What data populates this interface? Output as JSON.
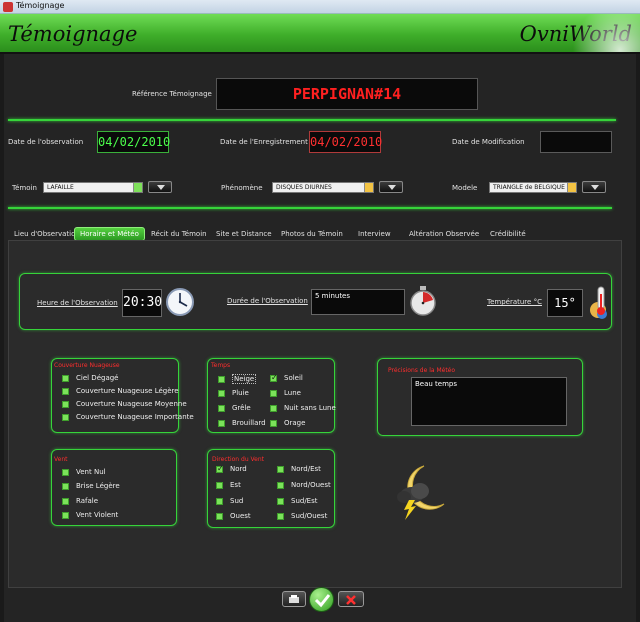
{
  "window": {
    "title": "Témoignage"
  },
  "header": {
    "title": "Témoignage",
    "brand": "OvniWorld"
  },
  "reference": {
    "label": "Référence Témoignage",
    "value": "PERPIGNAN#14"
  },
  "dates": {
    "observation_label": "Date de l'observation",
    "observation_value": "04/02/2010",
    "enregistrement_label": "Date de l'Enregistrement",
    "enregistrement_value": "04/02/2010",
    "modification_label": "Date de Modification",
    "modification_value": ""
  },
  "selectors": {
    "temoin_label": "Témoin",
    "temoin_value": "LAFAILLE",
    "phenomene_label": "Phénomène",
    "phenomene_value": "DISQUES DIURNES",
    "modele_label": "Modele",
    "modele_value": "TRIANGLE de BELGIQUE"
  },
  "tabs": [
    {
      "label": "Lieu d'Observation"
    },
    {
      "label": "Horaire et Météo"
    },
    {
      "label": "Récit du Témoin"
    },
    {
      "label": "Site et Distance"
    },
    {
      "label": "Photos du Témoin"
    },
    {
      "label": "Interview"
    },
    {
      "label": "Altération Observée"
    },
    {
      "label": "Crédibilité"
    }
  ],
  "horaire": {
    "heure_label": "Heure de l'Observation",
    "heure_value": "20:30",
    "duree_label": "Durée de l'Observation",
    "duree_value": "5 minutes",
    "temperature_label": "Température °C",
    "temperature_value": "15°"
  },
  "couverture": {
    "title": "Couverture Nuageuse",
    "items": [
      {
        "label": "Ciel Dégagé",
        "checked": false
      },
      {
        "label": "Couverture Nuageuse Légère",
        "checked": false
      },
      {
        "label": "Couverture Nuageuse Moyenne",
        "checked": false
      },
      {
        "label": "Couverture Nuageuse Importante",
        "checked": false
      }
    ]
  },
  "temps": {
    "title": "Temps",
    "items": [
      {
        "label": "Neige",
        "checked": false
      },
      {
        "label": "Soleil",
        "checked": true
      },
      {
        "label": "Pluie",
        "checked": false
      },
      {
        "label": "Lune",
        "checked": false
      },
      {
        "label": "Grêle",
        "checked": false
      },
      {
        "label": "Nuit sans Lune",
        "checked": false
      },
      {
        "label": "Brouillard",
        "checked": false
      },
      {
        "label": "Orage",
        "checked": false
      }
    ]
  },
  "precisions": {
    "title": "Précisions de la Météo",
    "value": "Beau temps"
  },
  "vent": {
    "title": "Vent",
    "items": [
      {
        "label": "Vent Nul",
        "checked": false
      },
      {
        "label": "Brise Légère",
        "checked": false
      },
      {
        "label": "Rafale",
        "checked": false
      },
      {
        "label": "Vent Violent",
        "checked": false
      }
    ]
  },
  "direction": {
    "title": "Direction du Vent",
    "items": [
      {
        "label": "Nord",
        "checked": true
      },
      {
        "label": "Nord/Est",
        "checked": false
      },
      {
        "label": "Est",
        "checked": false
      },
      {
        "label": "Nord/Ouest",
        "checked": false
      },
      {
        "label": "Sud",
        "checked": false
      },
      {
        "label": "Sud/Est",
        "checked": false
      },
      {
        "label": "Ouest",
        "checked": false
      },
      {
        "label": "Sud/Ouest",
        "checked": false
      }
    ]
  },
  "icons": {
    "clock": "clock-icon",
    "stopwatch": "stopwatch-icon",
    "thermometer": "thermometer-icon",
    "weather": "moon-storm-icon",
    "print": "print-icon",
    "validate": "check-icon",
    "cancel": "cancel-icon"
  },
  "colors": {
    "accent": "#36d43a",
    "alert": "#ff2d2d",
    "header": "#4bc236"
  }
}
